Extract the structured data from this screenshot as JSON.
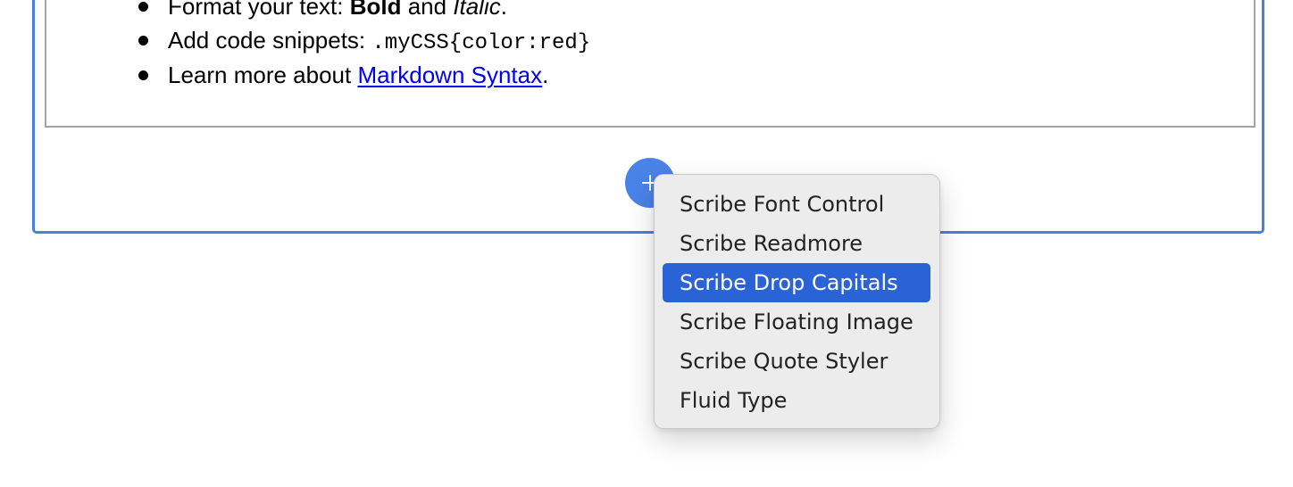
{
  "content": {
    "bullets": {
      "format": {
        "prefix": "Format your text: ",
        "bold": "Bold",
        "middle": " and ",
        "italic": "Italic",
        "suffix": "."
      },
      "code": {
        "prefix": "Add code snippets: ",
        "snippet": ".myCSS{color:red}"
      },
      "learn": {
        "prefix": "Learn more about ",
        "link_text": "Markdown Syntax",
        "suffix": "."
      }
    }
  },
  "add_button": {
    "icon": "plus-icon"
  },
  "menu": {
    "items": [
      {
        "label": "Scribe Font Control"
      },
      {
        "label": "Scribe Readmore"
      },
      {
        "label": "Scribe Drop Capitals"
      },
      {
        "label": "Scribe Floating Image"
      },
      {
        "label": "Scribe Quote Styler"
      },
      {
        "label": "Fluid Type"
      }
    ],
    "selected_label": "Scribe Drop Capitals"
  },
  "colors": {
    "accent": "#4a83e8",
    "frame": "#4a7fe0",
    "selected": "#2a63d6",
    "link": "#0000ee",
    "menu_background": "#ececec"
  }
}
